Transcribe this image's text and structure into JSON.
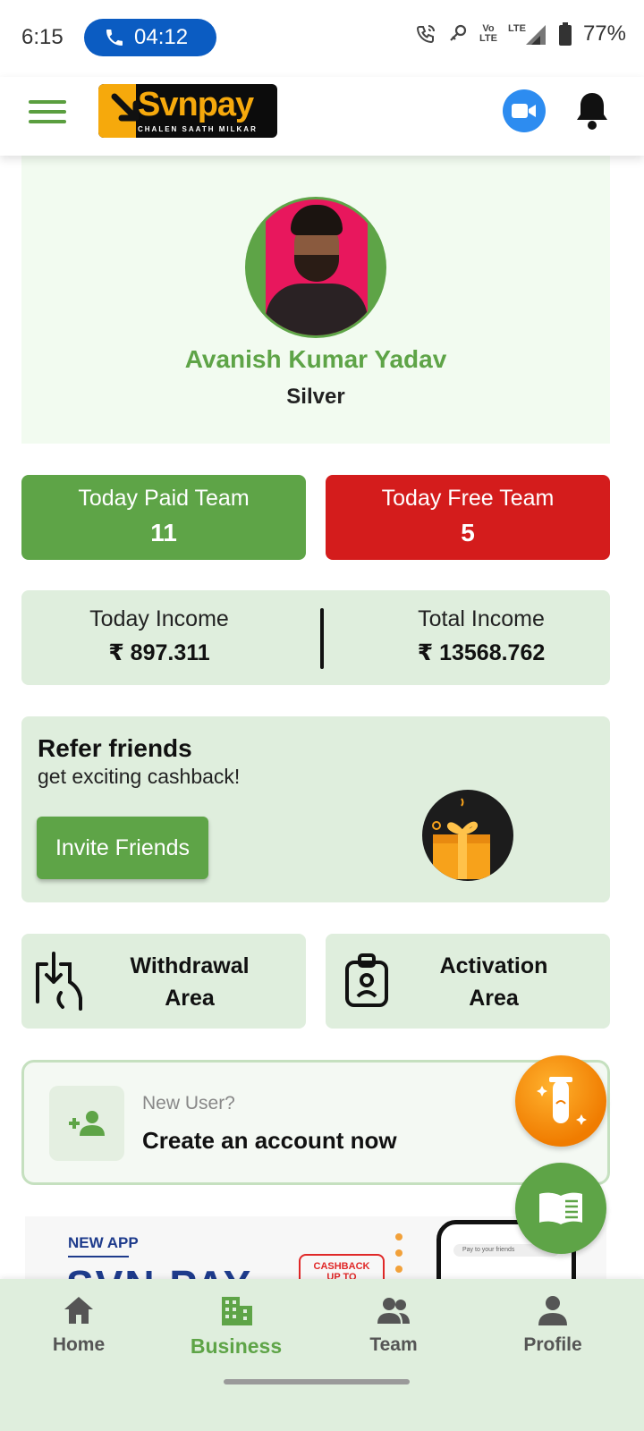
{
  "status_bar": {
    "time": "6:15",
    "call_timer": "04:12",
    "network_small": "Vo)\nLTE",
    "network_lte": "LTE",
    "battery": "77%"
  },
  "header": {
    "logo_text": "Svnpay",
    "logo_tagline": "CHALEN SAATH MILKAR",
    "accent_color": "#5ea447"
  },
  "profile": {
    "name": "Avanish Kumar Yadav",
    "rank": "Silver"
  },
  "team_stats": {
    "paid": {
      "label": "Today Paid Team",
      "value": "11",
      "color": "#5ea447"
    },
    "free": {
      "label": "Today Free Team",
      "value": "5",
      "color": "#d41c1c"
    }
  },
  "income": {
    "today": {
      "label": "Today Income",
      "value": "₹ 897.311"
    },
    "total": {
      "label": "Total Income",
      "value": "₹ 13568.762"
    }
  },
  "refer": {
    "title": "Refer friends",
    "subtitle": "get exciting cashback!",
    "button": "Invite Friends"
  },
  "areas": {
    "withdrawal_line1": "Withdrawal",
    "withdrawal_line2": "Area",
    "activation_line1": "Activation",
    "activation_line2": "Area"
  },
  "new_user": {
    "question": "New User?",
    "cta": "Create an account now"
  },
  "banner": {
    "new_app": "NEW APP",
    "headline": "SVN PAY",
    "cashback": "CASHBACK\nUP TO",
    "search_placeholder": "Pay to your friends"
  },
  "bottom_nav": {
    "items": [
      {
        "label": "Home",
        "icon": "home-icon"
      },
      {
        "label": "Business",
        "icon": "business-icon",
        "active": true
      },
      {
        "label": "Team",
        "icon": "team-icon"
      },
      {
        "label": "Profile",
        "icon": "profile-icon"
      }
    ]
  }
}
